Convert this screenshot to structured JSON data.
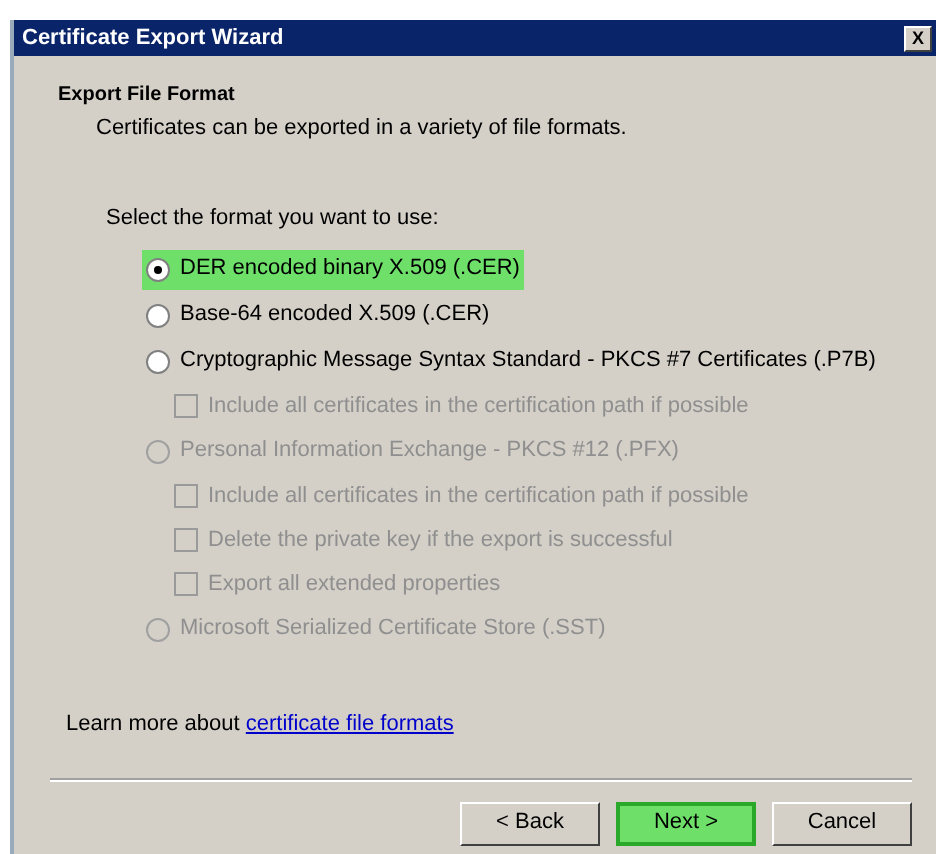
{
  "window": {
    "title": "Certificate Export Wizard",
    "close": "X"
  },
  "header": {
    "title": "Export File Format",
    "subtitle": "Certificates can be exported in a variety of file formats."
  },
  "prompt": "Select the format you want to use:",
  "options": [
    {
      "label": "DER encoded binary X.509 (.CER)",
      "selected": true,
      "disabled": false,
      "highlighted": true
    },
    {
      "label": "Base-64 encoded X.509 (.CER)",
      "selected": false,
      "disabled": false,
      "highlighted": false
    },
    {
      "label": "Cryptographic Message Syntax Standard - PKCS #7 Certificates (.P7B)",
      "selected": false,
      "disabled": false,
      "highlighted": false,
      "children": [
        {
          "label": "Include all certificates in the certification path if possible",
          "checked": false,
          "disabled": true
        }
      ]
    },
    {
      "label": "Personal Information Exchange - PKCS #12 (.PFX)",
      "selected": false,
      "disabled": true,
      "highlighted": false,
      "children": [
        {
          "label": "Include all certificates in the certification path if possible",
          "checked": false,
          "disabled": true
        },
        {
          "label": "Delete the private key if the export is successful",
          "checked": false,
          "disabled": true
        },
        {
          "label": "Export all extended properties",
          "checked": false,
          "disabled": true
        }
      ]
    },
    {
      "label": "Microsoft Serialized Certificate Store (.SST)",
      "selected": false,
      "disabled": true,
      "highlighted": false
    }
  ],
  "learn_more": {
    "text": "Learn more about",
    "link": "certificate file formats"
  },
  "buttons": [
    {
      "label": "< Back",
      "highlighted": false
    },
    {
      "label": "Next >",
      "highlighted": true
    },
    {
      "label": "Cancel",
      "highlighted": false
    }
  ]
}
